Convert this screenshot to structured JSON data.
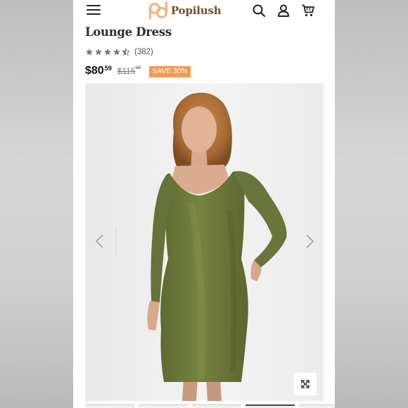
{
  "header": {
    "brand_name": "Popilush",
    "icons": [
      "menu-icon",
      "popilush-logo",
      "search-icon",
      "account-icon",
      "cart-icon"
    ]
  },
  "product": {
    "title": "Lounge Dress",
    "rating": {
      "stars": 4.5,
      "max_stars": 5,
      "review_count_label": "(382)"
    },
    "price": {
      "current_main": "$80",
      "current_cents": "59",
      "original_main": "$115",
      "original_cents": "00",
      "save_label": "SAVE 30%"
    }
  },
  "gallery": {
    "prev_icon": "chevron-left-icon",
    "next_icon": "chevron-right-icon",
    "zoom_icon": "expand-icon",
    "dress_color": "#6f7a3c",
    "thumbnail_count": 5,
    "active_thumbnail": 4
  },
  "colors": {
    "brand": "#7a4a2a",
    "logo_accent": "#f2b27a",
    "save_badge": "#f39a52",
    "star": "#7a7a7a"
  }
}
